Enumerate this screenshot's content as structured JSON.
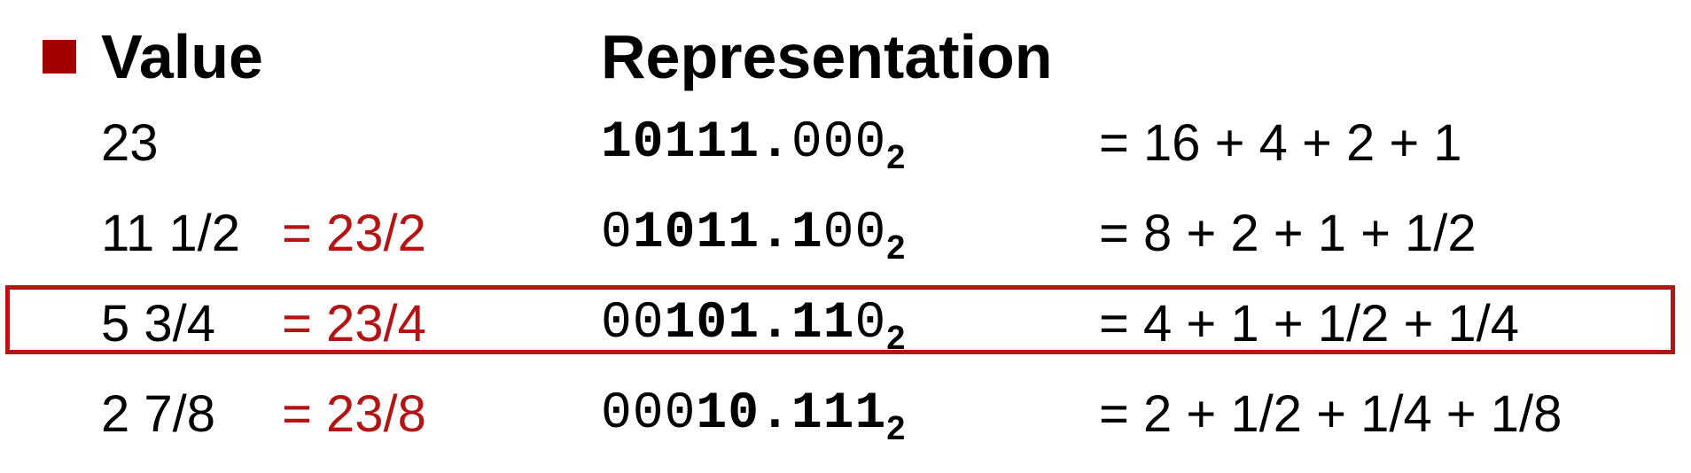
{
  "header": {
    "value_label": "Value",
    "representation_label": "Representation"
  },
  "rows": [
    {
      "value": "23",
      "fraction": "",
      "representation": [
        {
          "text": "10111.",
          "bold": true
        },
        {
          "text": "000",
          "bold": false
        }
      ],
      "base": "2",
      "sum": "= 16 + 4 + 2 + 1",
      "highlighted": false
    },
    {
      "value": "11 1/2",
      "fraction": "= 23/2",
      "representation": [
        {
          "text": "0",
          "bold": false
        },
        {
          "text": "1011.1",
          "bold": true
        },
        {
          "text": "00",
          "bold": false
        }
      ],
      "base": "2",
      "sum": "= 8 + 2 + 1 + 1/2",
      "highlighted": false
    },
    {
      "value": "5 3/4",
      "fraction": "= 23/4",
      "representation": [
        {
          "text": "00",
          "bold": false
        },
        {
          "text": "101.11",
          "bold": true
        },
        {
          "text": "0",
          "bold": false
        }
      ],
      "base": "2",
      "sum": "= 4 + 1 + 1/2  + 1/4",
      "highlighted": true
    },
    {
      "value": "2 7/8",
      "fraction": "= 23/8",
      "representation": [
        {
          "text": "000",
          "bold": false
        },
        {
          "text": "10.111",
          "bold": true
        }
      ],
      "base": "2",
      "sum": "= 2 + 1/2  + 1/4 + 1/8",
      "highlighted": false
    }
  ],
  "colors": {
    "bullet": "#a30000",
    "fraction_text": "#b41414",
    "highlight_border": "#b41414"
  }
}
